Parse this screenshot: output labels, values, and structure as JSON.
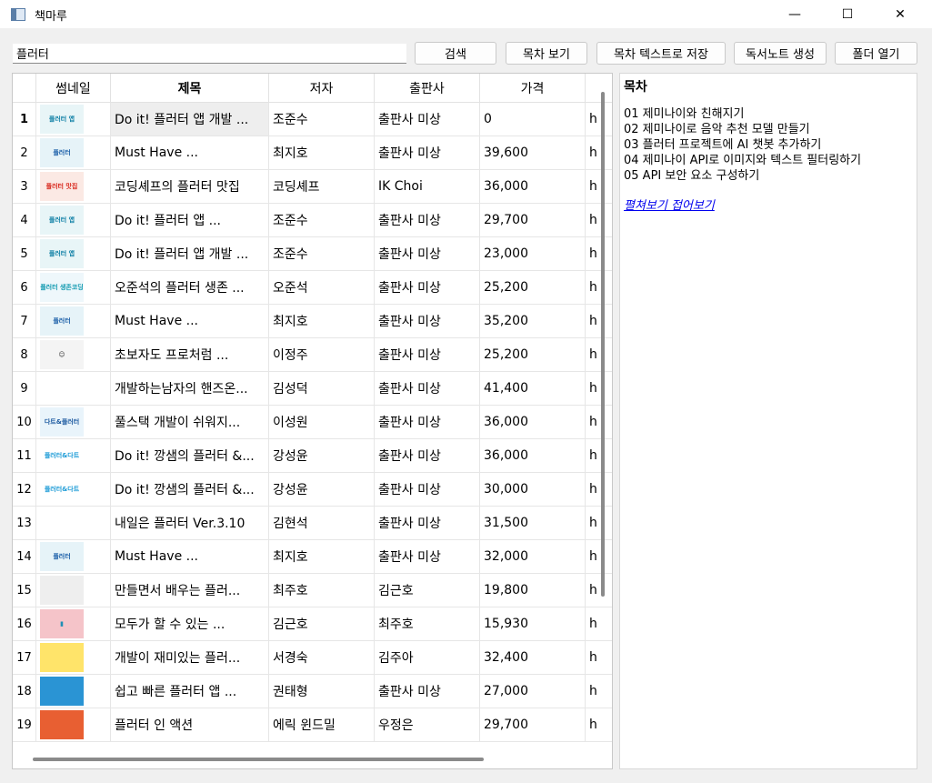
{
  "window": {
    "title": "책마루",
    "minimize": "—",
    "maximize": "☐",
    "close": "✕"
  },
  "search": {
    "value": "플러터"
  },
  "toolbar": {
    "search_label": "검색",
    "toc_view_label": "목차 보기",
    "toc_save_label": "목차 텍스트로  저장",
    "note_label": "독서노트 생성",
    "folder_label": "폴더 열기"
  },
  "table": {
    "headers": [
      "썸네일",
      "제목",
      "저자",
      "출판사",
      "가격",
      "h"
    ],
    "rows": [
      {
        "num": "1",
        "title": "Do it! 플러터 앱 개발 ...",
        "author": "조준수",
        "publisher": "출판사 미상",
        "price": "0",
        "extra": "h"
      },
      {
        "num": "2",
        "title": "Must Have ...",
        "author": "최지호",
        "publisher": "출판사 미상",
        "price": "39,600",
        "extra": "h"
      },
      {
        "num": "3",
        "title": "코딩셰프의 플러터 맛집",
        "author": "코딩셰프",
        "publisher": "IK Choi",
        "price": "36,000",
        "extra": "h"
      },
      {
        "num": "4",
        "title": "Do it! 플러터 앱 ...",
        "author": "조준수",
        "publisher": "출판사 미상",
        "price": "29,700",
        "extra": "h"
      },
      {
        "num": "5",
        "title": "Do it! 플러터 앱 개발 ...",
        "author": "조준수",
        "publisher": "출판사 미상",
        "price": "23,000",
        "extra": "h"
      },
      {
        "num": "6",
        "title": "오준석의 플러터 생존 ...",
        "author": "오준석",
        "publisher": "출판사 미상",
        "price": "25,200",
        "extra": "h"
      },
      {
        "num": "7",
        "title": "Must Have ...",
        "author": "최지호",
        "publisher": "출판사 미상",
        "price": "35,200",
        "extra": "h"
      },
      {
        "num": "8",
        "title": "초보자도 프로처럼 ...",
        "author": "이정주",
        "publisher": "출판사 미상",
        "price": "25,200",
        "extra": "h"
      },
      {
        "num": "9",
        "title": "개발하는남자의 핸즈온...",
        "author": "김성덕",
        "publisher": "출판사 미상",
        "price": "41,400",
        "extra": "h"
      },
      {
        "num": "10",
        "title": "풀스택 개발이 쉬워지...",
        "author": "이성원",
        "publisher": "출판사 미상",
        "price": "36,000",
        "extra": "h"
      },
      {
        "num": "11",
        "title": "Do it! 깡샘의 플러터 &...",
        "author": "강성윤",
        "publisher": "출판사 미상",
        "price": "36,000",
        "extra": "h"
      },
      {
        "num": "12",
        "title": "Do it! 깡샘의 플러터 &...",
        "author": "강성윤",
        "publisher": "출판사 미상",
        "price": "30,000",
        "extra": "h"
      },
      {
        "num": "13",
        "title": "내일은 플러터 Ver.3.10",
        "author": "김현석",
        "publisher": "출판사 미상",
        "price": "31,500",
        "extra": "h"
      },
      {
        "num": "14",
        "title": "Must Have ...",
        "author": "최지호",
        "publisher": "출판사 미상",
        "price": "32,000",
        "extra": "h"
      },
      {
        "num": "15",
        "title": "만들면서 배우는 플러...",
        "author": "최주호",
        "publisher": "김근호",
        "price": "19,800",
        "extra": "h"
      },
      {
        "num": "16",
        "title": "모두가 할 수 있는 ...",
        "author": "김근호",
        "publisher": "최주호",
        "price": "15,930",
        "extra": "h"
      },
      {
        "num": "17",
        "title": "개발이 재미있는 플러...",
        "author": "서경숙",
        "publisher": "김주아",
        "price": "32,400",
        "extra": "h"
      },
      {
        "num": "18",
        "title": "쉽고 빠른 플러터 앱 ...",
        "author": "권태형",
        "publisher": "출판사 미상",
        "price": "27,000",
        "extra": "h"
      },
      {
        "num": "19",
        "title": "플러터 인 액션",
        "author": "에릭 윈드밀",
        "publisher": "우정은",
        "price": "29,700",
        "extra": "h"
      }
    ]
  },
  "thumbnails": [
    {
      "bg": "#e8f5f7",
      "fg": "#0d7fa5",
      "text": "플러터 앱"
    },
    {
      "bg": "#e6f3f8",
      "fg": "#1b5fa8",
      "text": "플러터"
    },
    {
      "bg": "#fbe9e4",
      "fg": "#d8261b",
      "text": "플러터 맛집"
    },
    {
      "bg": "#e8f5f7",
      "fg": "#0d7fa5",
      "text": "플러터 앱"
    },
    {
      "bg": "#e8f5f7",
      "fg": "#0d7fa5",
      "text": "플러터 앱"
    },
    {
      "bg": "#eef7fb",
      "fg": "#119ab0",
      "text": "플러터 생존코딩"
    },
    {
      "bg": "#e6f3f8",
      "fg": "#1b5fa8",
      "text": "플러터"
    },
    {
      "bg": "#f4f4f4",
      "fg": "#333333",
      "text": "☺"
    },
    {
      "bg": "#ffffff",
      "fg": "#234f8a",
      "text": ""
    },
    {
      "bg": "#e9f4fb",
      "fg": "#1c5aa0",
      "text": "다트&플러터"
    },
    {
      "bg": "#ffffff",
      "fg": "#1a9ad6",
      "text": "플러터&다트"
    },
    {
      "bg": "#ffffff",
      "fg": "#1a9ad6",
      "text": "플러터&다트"
    },
    {
      "bg": "#ffffff",
      "fg": "#666666",
      "text": ""
    },
    {
      "bg": "#e6f3f8",
      "fg": "#1b5fa8",
      "text": "플러터"
    },
    {
      "bg": "#eeeeee",
      "fg": "#555555",
      "text": ""
    },
    {
      "bg": "#f5c4c9",
      "fg": "#1f8fb5",
      "text": "▮"
    },
    {
      "bg": "#ffe46a",
      "fg": "#1f4fa8",
      "text": ""
    },
    {
      "bg": "#2a94d4",
      "fg": "#ffffff",
      "text": ""
    },
    {
      "bg": "#e85f32",
      "fg": "#ffffff",
      "text": ""
    }
  ],
  "toc": {
    "title": "목차",
    "items": [
      "01 제미나이와 친해지기",
      "02 제미나이로 음악 추천 모델 만들기",
      "03 플러터 프로젝트에 AI 챗봇 추가하기",
      "04 제미나이 API로 이미지와 텍스트 필터링하기",
      "05 API 보안 요소 구성하기"
    ],
    "toggle_link": "펼쳐보기 접어보기"
  }
}
